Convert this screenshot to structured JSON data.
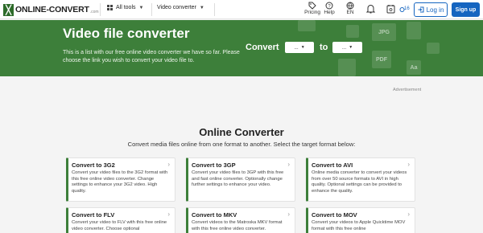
{
  "nav": {
    "logo_mark": "╳",
    "logo_text": "ONLINE-CONVERT",
    "logo_tld": ".com",
    "all_tools": "All tools",
    "video_converter": "Video converter",
    "pricing": "Pricing",
    "help": "Help",
    "language": "EN",
    "credits": "16",
    "login": "Log in",
    "signup": "Sign up",
    "accent": "#1565c0"
  },
  "hero": {
    "title": "Video file converter",
    "desc": "This is a list with our free online video converter we have so far. Please choose the link you wish to convert your video file to.",
    "convert_label": "Convert",
    "to_label": "to",
    "from_select": "...",
    "to_select": "...",
    "bg": "#3d7f3a",
    "deco_jpg": "JPG",
    "deco_pdf": "PDF",
    "deco_aa": "Aa"
  },
  "ad_label": "Advertisement",
  "section": {
    "title": "Online Converter",
    "subtitle": "Convert media files online from one format to another. Select the target format below:"
  },
  "cards": [
    {
      "title": "Convert to 3G2",
      "desc": "Convert your video files to the 3G2 format with this free online video converter. Change settings to enhance your 3G2 video. High quality."
    },
    {
      "title": "Convert to 3GP",
      "desc": "Convert your video files to 3GP with this free and fast online converter. Optionally change further settings to enhance your video."
    },
    {
      "title": "Convert to AVI",
      "desc": "Online media converter to convert your videos from over 50 source formats to AVI in high quality. Optional settings can be provided to enhance the quality."
    },
    {
      "title": "Convert to FLV",
      "desc": "Convert your video to FLV with this free online video converter. Choose optional"
    },
    {
      "title": "Convert to MKV",
      "desc": "Convert videos to the Matroska MKV format with this free online video converter."
    },
    {
      "title": "Convert to MOV",
      "desc": "Convert your videos to Apple Quicktime MOV format with this free online"
    }
  ]
}
